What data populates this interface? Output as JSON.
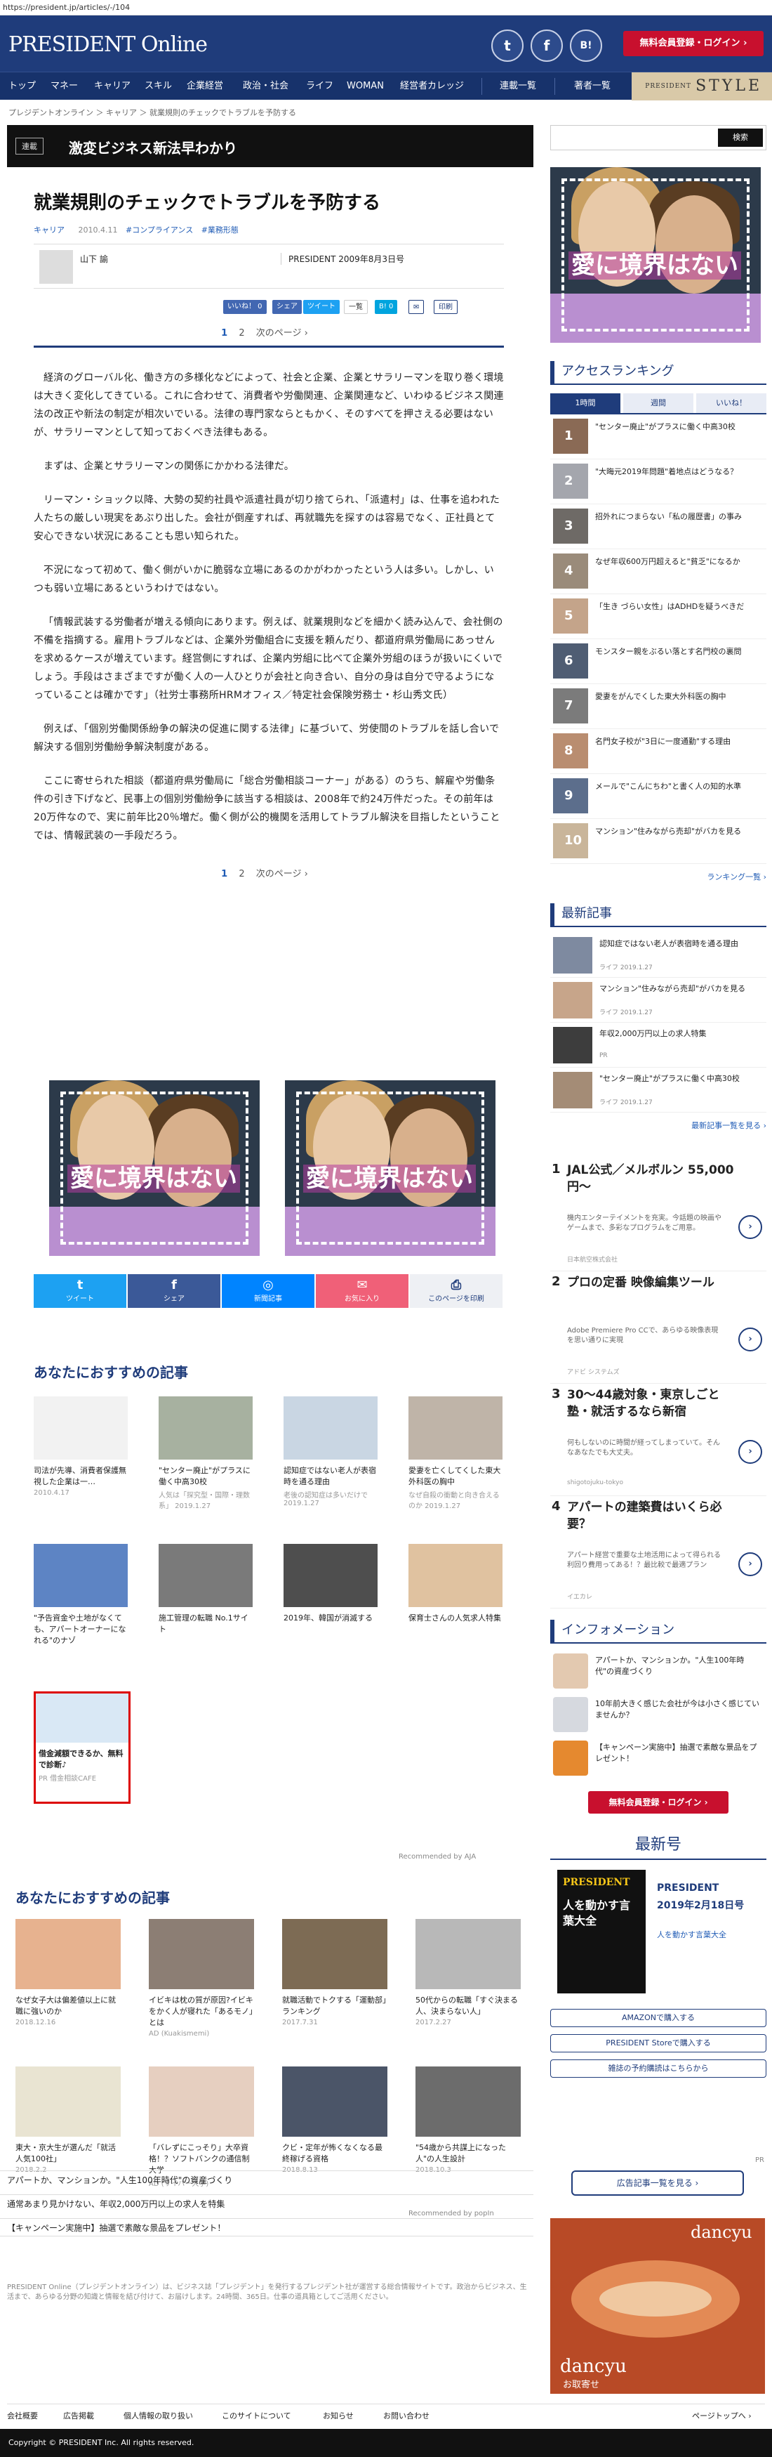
{
  "url": "https://president.jp/articles/-/104",
  "header": {
    "logo_main": "PRESIDENT",
    "logo_sub": " Online",
    "social": [
      "t",
      "f",
      "B!"
    ],
    "register_btn": "無料会員登録・ログイン ›"
  },
  "nav": {
    "items": [
      "トップ",
      "マネー",
      "キャリア",
      "スキル",
      "企業経営",
      "政治・社会",
      "ライフ",
      "WOMAN",
      "経営者カレッジ",
      "連載一覧",
      "著者一覧"
    ],
    "style_label_small": "PRESIDENT",
    "style_label": "STYLE"
  },
  "breadcrumb": "プレジデントオンライン ＞ キャリア ＞ 就業規則のチェックでトラブルを予防する",
  "serial": {
    "tag": "連載",
    "title": "激変ビジネス新法早わかり"
  },
  "article": {
    "title": "就業規則のチェックでトラブルを予防する",
    "category": "キャリア",
    "date": "2010.4.11",
    "tags": [
      "#コンプライアンス",
      "#業務形態"
    ],
    "author": "山下 諭",
    "pubinfo": "PRESIDENT 2009年8月3日号",
    "share": [
      "いいね！ 0",
      "シェア",
      "ツイート",
      "一覧",
      "B! 0",
      "✉",
      "印刷"
    ],
    "pager": {
      "p1": "1",
      "p2": "2",
      "next": "次のページ ›"
    },
    "paragraphs": [
      "経済のグローバル化、働き方の多様化などによって、社会と企業、企業とサラリーマンを取り巻く環境は大きく変化してきている。これに合わせて、消費者や労働関連、企業関連など、いわゆるビジネス関連法の改正や新法の制定が相次いでいる。法律の専門家ならともかく、そのすべてを押さえる必要はないが、サラリーマンとして知っておくべき法律もある。",
      "まずは、企業とサラリーマンの関係にかかわる法律だ。",
      "リーマン・ショック以降、大勢の契約社員や派遣社員が切り捨てられ、「派遣村」は、仕事を追われた人たちの厳しい現実をあぶり出した。会社が倒産すれば、再就職先を探すのは容易でなく、正社員とて安心できない状況にあることも思い知られた。",
      "不況になって初めて、働く側がいかに脆弱な立場にあるのかがわかったという人は多い。しかし、いつも弱い立場にあるというわけではない。",
      "「情報武装する労働者が増える傾向にあります。例えば、就業規則などを細かく読み込んで、会社側の不備を指摘する。雇用トラブルなどは、企業外労働組合に支援を頼んだり、都道府県労働局にあっせんを求めるケースが増えています。経営側にすれば、企業内労組に比べて企業外労組のほうが扱いにくいでしょう。手段はさまざまですが働く人の一人ひとりが会社と向き合い、自分の身は自分で守るようになっていることは確かです」（社労士事務所HRMオフィス／特定社会保険労務士・杉山秀文氏）",
      "例えば、「個別労働関係紛争の解決の促進に関する法律」に基づいて、労使間のトラブルを話し合いで解決する個別労働紛争解決制度がある。",
      "ここに寄せられた相談（都道府県労働局に「総合労働相談コーナー」がある）のうち、解雇や労働条件の引き下げなど、民事上の個別労働紛争に該当する相談は、2008年で約24万件だった。その前年は20万件なので、実に前年比20％増だ。働く側が公的機関を活用してトラブル解決を目指したということでは、情報武装の一手段だろう。"
    ],
    "ad_slogan": "愛に境界はない"
  },
  "sharebar": [
    {
      "icon": "t",
      "label": "ツイート"
    },
    {
      "icon": "f",
      "label": "シェア"
    },
    {
      "icon": "◎",
      "label": "新聞記事"
    },
    {
      "icon": "✉",
      "label": "お気に入り"
    },
    {
      "icon": "⎙",
      "label": "このページを印刷"
    }
  ],
  "rec1": {
    "title": "あなたにおすすめの記事",
    "cards": [
      {
        "title": "司法が先導、消費者保護無視した企業は一…",
        "date": "2010.4.17"
      },
      {
        "title": "\"センター廃止\"がプラスに働く中高30校",
        "date": "人気は「探究型・国際・理数系」 2019.1.27"
      },
      {
        "title": "認知症ではない老人が表宿時を通る理由",
        "date": "老後の認知症は多いだけで 2019.1.27"
      },
      {
        "title": "愛妻を亡くしてくした東大外科医の胸中",
        "date": "なぜ自殺の衝動と向き合えるのか 2019.1.27"
      },
      {
        "title": "\"予告資金や土地がなくても、アパートオーナーになれる\"のナゾ",
        "date": ""
      },
      {
        "title": "施工管理の転職 No.1サイト",
        "date": ""
      },
      {
        "title": "2019年、韓国が消滅する",
        "date": ""
      },
      {
        "title": "保育士さんの人気求人特集",
        "date": ""
      },
      {
        "title": "借金減額できるか、無料で診断♪",
        "date": "PR 借金相談CAFE"
      }
    ],
    "recommended_by": "Recommended by AJA"
  },
  "rec2": {
    "title": "あなたにおすすめの記事",
    "cards": [
      {
        "title": "なぜ女子大は偏差値以上に就職に強いのか",
        "date": "2018.12.16"
      },
      {
        "title": "イビキは枕の質が原因?イビキをかく人が寝れた「あるモノ」とは",
        "date": "AD (Kuakismemi)"
      },
      {
        "title": "就職活動でトクする「運動部」ランキング",
        "date": "2017.7.31"
      },
      {
        "title": "50代からの転職「すぐ決まる人、決まらない人」",
        "date": "2017.2.27"
      },
      {
        "title": "東大・京大生が選んだ「就活人気100社」",
        "date": "2018.2.2"
      },
      {
        "title": "「バレずにこっそり」大卒資格！？ソフトバンクの通信制大学",
        "date": "AD (サイバー大学)"
      },
      {
        "title": "クビ・定年が怖くなくなる最終稼げる資格",
        "date": "2018.8.13"
      },
      {
        "title": "\"54歳から共謀上になった人\"の人生設計",
        "date": "2018.10.3"
      }
    ],
    "recommended_by": "Recommended by popIn"
  },
  "sidebar": {
    "search_btn": "検索",
    "ranking_title": "アクセスランキング",
    "tabs": [
      "1時間",
      "週間",
      "いいね！"
    ],
    "ranking": [
      "\"センター廃止\"がプラスに働く中高30校",
      "\"大晦元2019年問題\"着地点はどうなる？",
      "招外れにつまらない「私の履歴書」の事み",
      "なぜ年収600万円超えると\"貧乏\"になるか",
      "「生き づらい女性」はADHDを疑うべきだ",
      "モンスター親をぶるい落とす名門校の裏問",
      "愛妻をがんでくした東大外科医の胸中",
      "名門女子校が\"3日に一度通勤\"する理由",
      "メールで\"こんにちわ\"と書く人の知的水準",
      "マンション\"住みながら売却\"がバカを見る"
    ],
    "ranking_more": "ランキング一覧 ›",
    "latest_title": "最新記事",
    "latest": [
      {
        "title": "認知症ではない老人が表宿時を通る理由",
        "meta": "ライフ 2019.1.27"
      },
      {
        "title": "マンション\"住みながら売却\"がバカを見る",
        "meta": "ライフ 2019.1.27"
      },
      {
        "title": "年収2,000万円以上の求人特集",
        "meta": "PR"
      },
      {
        "title": "\"センター廃止\"がプラスに働く中高30校",
        "meta": "ライフ 2019.1.27"
      }
    ],
    "latest_more": "最新記事一覧を見る ›",
    "ads": [
      {
        "num": "1",
        "title": "JAL公式／メルボルン 55,000円〜",
        "desc": "機内エンターテイメントを充実。今話題の映画やゲームまで、多彩なプログラムをご用意。",
        "src": "日本航空株式会社"
      },
      {
        "num": "2",
        "title": "プロの定番 映像編集ツール",
        "desc": "Adobe Premiere Pro CCで、あらゆる映像表現を思い通りに実現",
        "src": "アドビ システムズ"
      },
      {
        "num": "3",
        "title": "30〜44歳対象・東京しごと塾・就活するなら新宿",
        "desc": "何もしないのに時間が経ってしまっていて。そんなあなたでも大丈夫。",
        "src": "shigotojuku-tokyo"
      },
      {
        "num": "4",
        "title": "アパートの建築費はいくら必要？",
        "desc": "アパート経営で重要な土地活用によって得られる利回り費用ってある！？最比較で最適プラン",
        "src": "イエカレ"
      }
    ],
    "info_title": "インフォメーション",
    "info": [
      "アパートか、マンションか。\"人生100年時代\"の資産づくり",
      "10年前大きく感じた会社が今は小さく感じていませんか？",
      "【キャンペーン実施中】抽選で素敵な景品をプレゼント！"
    ],
    "register_btn": "無料会員登録・ログイン ›",
    "latest_issue_title": "最新号",
    "issue_cover_title": "人を動かす言葉大全",
    "issue_name": "PRESIDENT",
    "issue_date": "2019年2月18日号",
    "issue_sub": "人を動かす言葉大全",
    "links": [
      "AMAZONで購入する",
      "PRESIDENT Storeで購入する",
      "雑誌の予約購読はこちらから"
    ],
    "ad_list_btn": "広告記事一覧を見る ›",
    "dancyu_title": "dancyu",
    "dancyu_sub": "お取寄せ"
  },
  "footer": {
    "pr_label": "PR",
    "pr_lines": [
      "アパートか、マンションか。\"人生100年時代\"の資産づくり",
      "通常あまり見かけない、年収2,000万円以上の求人を特集",
      "【キャンペーン実施中】抽選で素敵な景品をプレゼント！"
    ],
    "about": "PRESIDENT Online（プレジデントオンライン）は、ビジネス誌「プレジデント」を発行するプレジデント社が運営する総合情報サイトです。政治からビジネス、生活まで、あらゆる分野の知識と情報を結び付けて、お届けします。24時間、365日。仕事の道具箱としてご活用ください。",
    "links": [
      "会社概要",
      "広告掲載",
      "個人情報の取り扱い",
      "このサイトについて",
      "お知らせ",
      "お問い合わせ"
    ],
    "pagetop": "ページトップへ ›",
    "copyright": "Copyright © PRESIDENT Inc. All rights reserved."
  }
}
